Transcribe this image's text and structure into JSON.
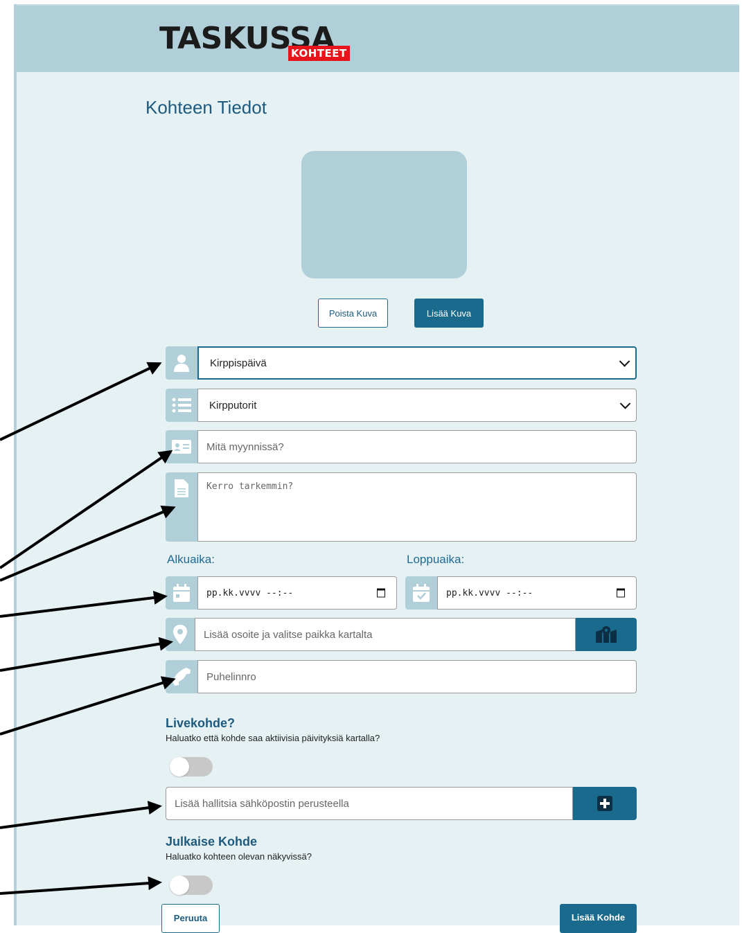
{
  "logo": {
    "main": "TASKUSSA",
    "badge": "KOHTEET"
  },
  "page_title": "Kohteen Tiedot",
  "photo_buttons": {
    "remove": "Poista Kuva",
    "add": "Lisää Kuva"
  },
  "form": {
    "category_select": {
      "value": "Kirppispäivä",
      "icon": "user-icon"
    },
    "type_select": {
      "value": "Kirpputorit",
      "icon": "list-icon"
    },
    "title_input": {
      "placeholder": "Mitä myynnissä?",
      "icon": "id-card-icon"
    },
    "description_textarea": {
      "placeholder": "Kerro tarkemmin?",
      "icon": "document-icon"
    },
    "start": {
      "label": "Alkuaika:",
      "value": "pp.kk.vvvv --:--",
      "icon": "calendar-icon"
    },
    "end": {
      "label": "Loppuaika:",
      "value": "pp.kk.vvvv --:--",
      "icon": "calendar-check-icon"
    },
    "address_input": {
      "placeholder": "Lisää osoite ja valitse paikka kartalta",
      "icon": "map-pin-icon",
      "button_icon": "map-icon"
    },
    "phone_input": {
      "placeholder": "Puhelinnro",
      "icon": "phone-icon"
    }
  },
  "live": {
    "heading": "Livekohde?",
    "description": "Haluatko että kohde saa aktiivisia päivityksiä kartalla?",
    "enabled": false
  },
  "admin_input": {
    "placeholder": "Lisää hallitsia sähköpostin perusteella",
    "button_icon": "plus-square-icon"
  },
  "publish": {
    "heading": "Julkaise Kohde",
    "description": "Haluatko kohteen olevan näkyvissä?",
    "enabled": false
  },
  "footer_buttons": {
    "cancel": "Peruuta",
    "submit": "Lisää Kohde"
  },
  "colors": {
    "primary": "#1a6a8e",
    "addon": "#b0cfd9",
    "background": "#e6f1f4",
    "badge": "#e8141c"
  }
}
